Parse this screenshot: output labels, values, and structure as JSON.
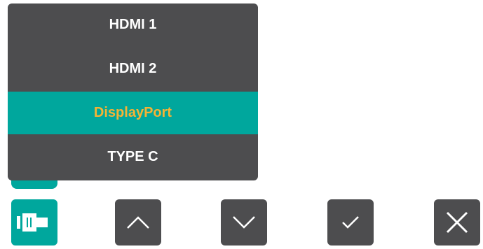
{
  "input_menu": {
    "items": [
      {
        "label": "HDMI 1"
      },
      {
        "label": "HDMI 2"
      },
      {
        "label": "DisplayPort",
        "selected": true
      },
      {
        "label": "TYPE C"
      }
    ]
  },
  "controls": {
    "buttons": [
      {
        "icon": "input-source-icon",
        "active": true
      },
      {
        "icon": "chevron-up-icon"
      },
      {
        "icon": "chevron-down-icon"
      },
      {
        "icon": "checkmark-icon"
      },
      {
        "icon": "close-icon"
      }
    ]
  },
  "colors": {
    "panel": "#4d4d4f",
    "accent": "#00a79d",
    "selected_text": "#f5b335",
    "text": "#ffffff"
  }
}
